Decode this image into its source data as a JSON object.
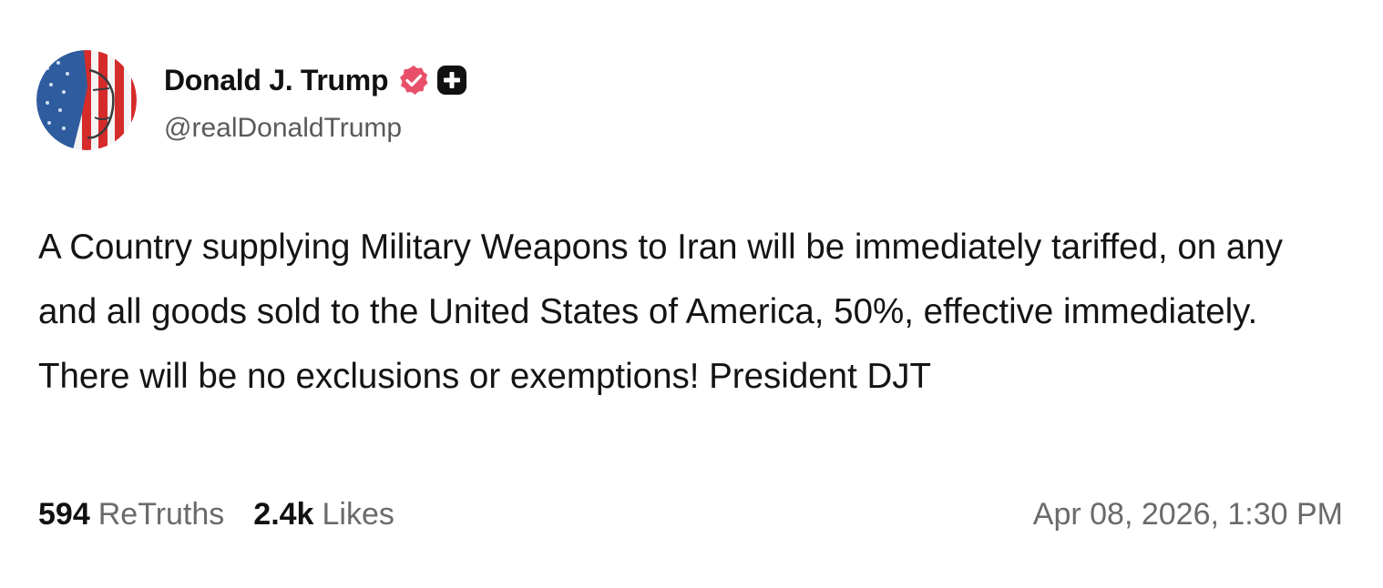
{
  "post": {
    "author": {
      "display_name": "Donald J. Trump",
      "handle": "@realDonaldTrump",
      "avatar_icon": "profile-avatar-flag-portrait",
      "verified_icon": "verified-badge-icon",
      "verified_color": "#e8506a",
      "plus_badge_icon": "plus-badge-icon"
    },
    "text": "A Country supplying Military Weapons to Iran will be immediately tariffed, on any and all goods sold to the United States of America, 50%, effective immediately. There will be no exclusions or exemptions! President DJT",
    "stats": {
      "retruths_count": "594",
      "retruths_label": "ReTruths",
      "likes_count": "2.4k",
      "likes_label": "Likes"
    },
    "timestamp": "Apr 08, 2026, 1:30 PM"
  }
}
